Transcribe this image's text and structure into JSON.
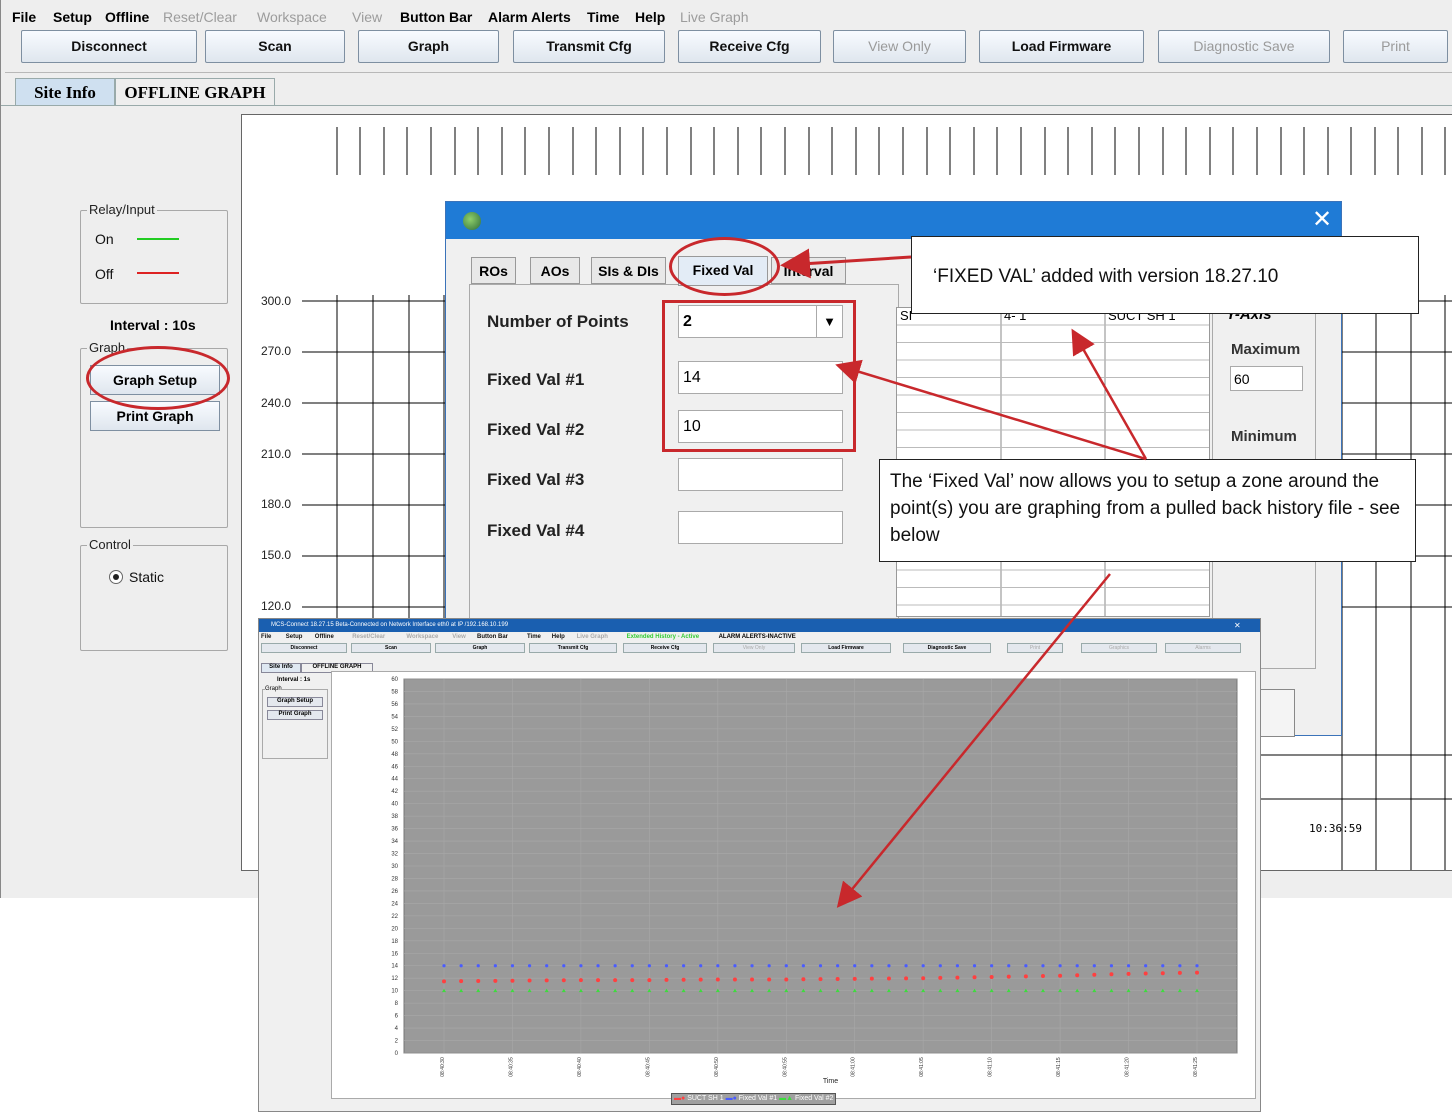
{
  "menu": {
    "items": [
      {
        "label": "File",
        "enabled": true
      },
      {
        "label": "Setup",
        "enabled": true
      },
      {
        "label": "Offline",
        "enabled": true
      },
      {
        "label": "Reset/Clear",
        "enabled": false
      },
      {
        "label": "Workspace",
        "enabled": false
      },
      {
        "label": "View",
        "enabled": false
      },
      {
        "label": "Button Bar",
        "enabled": true
      },
      {
        "label": "Alarm Alerts",
        "enabled": true
      },
      {
        "label": "Time",
        "enabled": true
      },
      {
        "label": "Help",
        "enabled": true
      },
      {
        "label": "Live Graph",
        "enabled": false
      }
    ]
  },
  "toolbar": {
    "buttons": [
      {
        "label": "Disconnect",
        "enabled": true
      },
      {
        "label": "Scan",
        "enabled": true
      },
      {
        "label": "Graph",
        "enabled": true
      },
      {
        "label": "Transmit Cfg",
        "enabled": true
      },
      {
        "label": "Receive Cfg",
        "enabled": true
      },
      {
        "label": "View Only",
        "enabled": false
      },
      {
        "label": "Load Firmware",
        "enabled": true
      },
      {
        "label": "Diagnostic Save",
        "enabled": false
      },
      {
        "label": "Print",
        "enabled": false
      }
    ]
  },
  "tabs": {
    "site_info": "Site Info",
    "offline_graph": "OFFLINE GRAPH"
  },
  "side": {
    "relay_group": "Relay/Input",
    "on_label": "On",
    "off_label": "Off",
    "interval": "Interval : 10s",
    "graph_group": "Graph",
    "graph_setup": "Graph Setup",
    "print_graph": "Print Graph",
    "control_group": "Control",
    "static_label": "Static"
  },
  "graph": {
    "y_ticks": [
      "300.0",
      "270.0",
      "240.0",
      "210.0",
      "180.0",
      "150.0",
      "120.0"
    ],
    "time_label": "10:36:59"
  },
  "dialog": {
    "tabs": [
      "ROs",
      "AOs",
      "SIs & DIs",
      "Fixed Val",
      "Interval"
    ],
    "points_label": "Number of Points",
    "points_value": "2",
    "fv1_label": "Fixed Val #1",
    "fv1_value": "14",
    "fv2_label": "Fixed Val #2",
    "fv2_value": "10",
    "fv3_label": "Fixed Val #3",
    "fv3_value": "",
    "fv4_label": "Fixed Val #4",
    "fv4_value": "",
    "table_headers": [
      "SI",
      "4- 1",
      "SUCT SH 1"
    ],
    "yaxis_label": "Y-Axis",
    "max_label": "Maximum",
    "max_value": "60",
    "min_label": "Minimum"
  },
  "callouts": {
    "fixed_added": "‘FIXED VAL’  added with version 18.27.10",
    "zone_note": "The ‘Fixed Val’ now allows you to setup a zone around the point(s) you are graphing from a pulled back history file - see below"
  },
  "inset": {
    "titlebar": "MCS-Connect 18.27.15 Beta-Connected on Network Interface eth0 at IP /192.168.10.199",
    "menu": [
      "File",
      "Setup",
      "Offline",
      "Reset/Clear",
      "Workspace",
      "View",
      "Button Bar",
      "Time",
      "Help",
      "Live Graph"
    ],
    "extended": "Extended History - Active",
    "alarm": "ALARM ALERTS-INACTIVE",
    "buttons": [
      "Disconnect",
      "Scan",
      "Graph",
      "Transmit Cfg",
      "Receive Cfg",
      "View Only",
      "Load Firmware",
      "Diagnostic Save",
      "Print",
      "Graphics",
      "Alarms"
    ],
    "tabs": [
      "Site Info",
      "OFFLINE GRAPH"
    ],
    "interval": "Interval : 1s",
    "graph_group": "Graph",
    "graph_setup": "Graph Setup",
    "print_graph": "Print Graph",
    "x_label": "Time",
    "legend": [
      "SUCT SH 1",
      "Fixed Val #1",
      "Fixed Val #2"
    ]
  },
  "colors": {
    "on": "#22cc22",
    "off": "#dd2222",
    "annot": "#c8282c",
    "s_suct": "#ff4040",
    "s_fv1": "#4a5cff",
    "s_fv2": "#3ddc3d"
  },
  "chart_data": {
    "type": "line",
    "title": "",
    "xlabel": "Time",
    "ylabel": "",
    "ylim": [
      0,
      60
    ],
    "y_ticks": [
      0,
      2,
      4,
      6,
      8,
      10,
      12,
      14,
      16,
      18,
      20,
      22,
      24,
      26,
      28,
      30,
      32,
      34,
      36,
      38,
      40,
      42,
      44,
      46,
      48,
      50,
      52,
      54,
      56,
      58,
      60
    ],
    "x": [
      "08:40:30",
      "08:40:35",
      "08:40:40",
      "08:40:45",
      "08:40:50",
      "08:40:55",
      "08:41:00",
      "08:41:05",
      "08:41:10",
      "08:41:15",
      "08:41:20",
      "08:41:25"
    ],
    "series": [
      {
        "name": "SUCT SH 1",
        "values": [
          11.5,
          11.6,
          11.7,
          11.7,
          11.8,
          11.8,
          11.9,
          12.0,
          12.2,
          12.4,
          12.7,
          12.9
        ]
      },
      {
        "name": "Fixed Val #1",
        "values": [
          14,
          14,
          14,
          14,
          14,
          14,
          14,
          14,
          14,
          14,
          14,
          14
        ]
      },
      {
        "name": "Fixed Val #2",
        "values": [
          10,
          10,
          10,
          10,
          10,
          10,
          10,
          10,
          10,
          10,
          10,
          10
        ]
      }
    ]
  }
}
